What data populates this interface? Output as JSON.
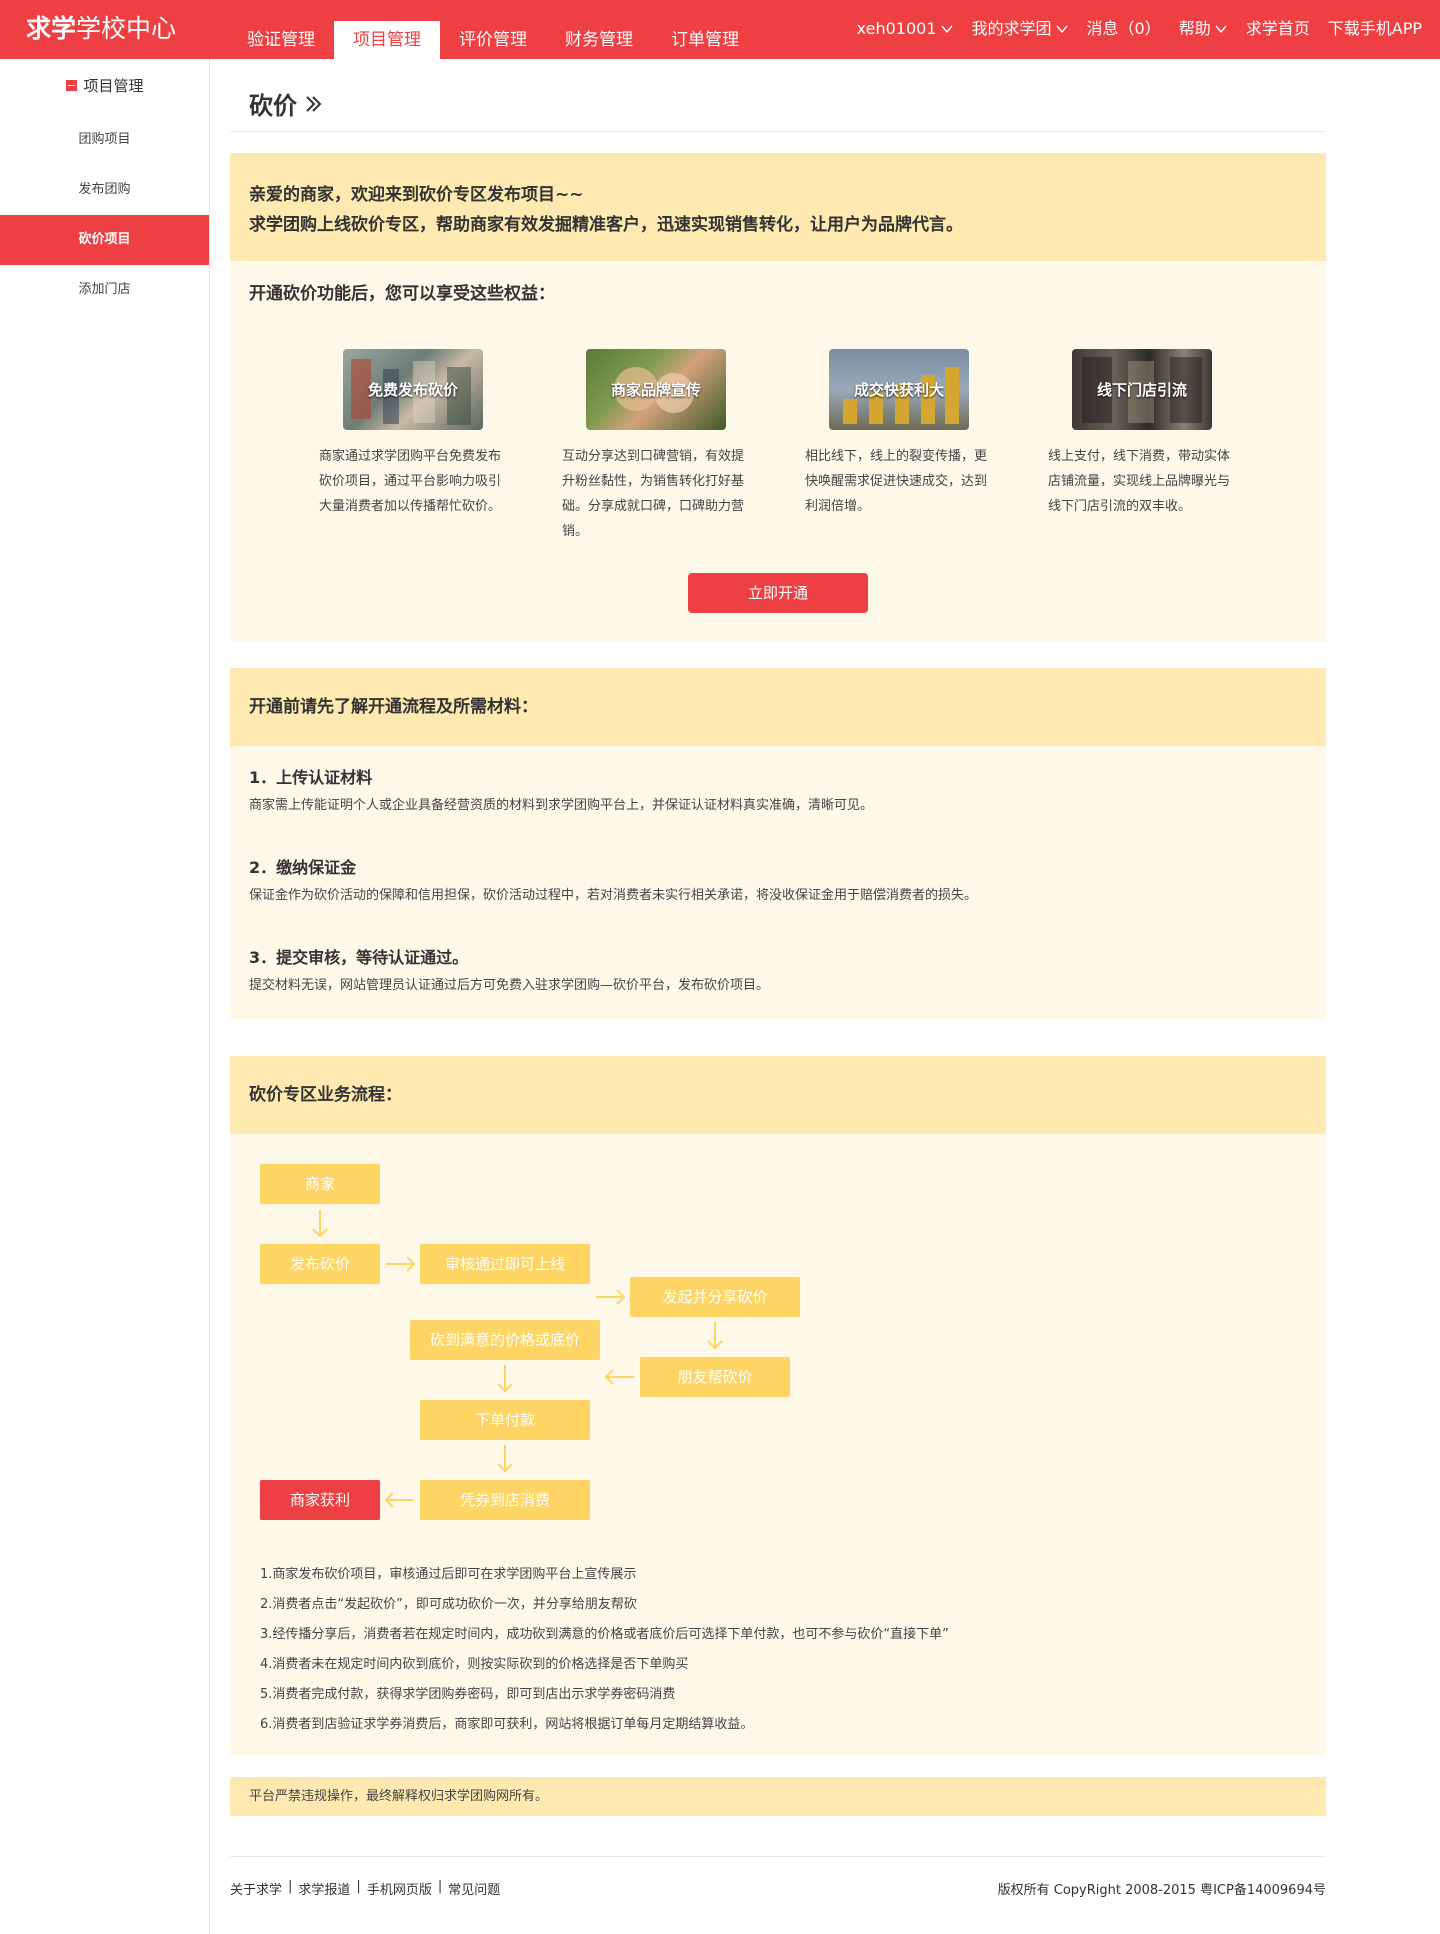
{
  "header": {
    "brand_bold": "求学",
    "brand_rest": "学校中心",
    "tabs": [
      {
        "label": "验证管理"
      },
      {
        "label": "项目管理"
      },
      {
        "label": "评价管理"
      },
      {
        "label": "财务管理"
      },
      {
        "label": "订单管理"
      }
    ],
    "active_tab": "项目管理",
    "links": {
      "user": "xeh01001",
      "my_group": "我的求学团",
      "messages": "消息（0）",
      "help": "帮助",
      "home": "求学首页",
      "app": "下载手机APP"
    },
    "color": "#ee3f43"
  },
  "sidebar": {
    "heading": "项目管理",
    "items": [
      {
        "label": "团购项目"
      },
      {
        "label": "发布团购"
      },
      {
        "label": "砍价项目"
      },
      {
        "label": "添加门店"
      }
    ],
    "active_item": "砍价项目"
  },
  "main": {
    "title": "砍价",
    "intro": {
      "line1": "亲爱的商家，欢迎来到砍价专区发布项目~~",
      "line2": "求学团购上线砍价专区，帮助商家有效发掘精准客户，迅速实现销售转化，让用户为品牌代言。"
    },
    "benefits_title": "开通砍价功能后，您可以享受这些权益：",
    "benefits": [
      {
        "caption": "免费发布砍价",
        "desc": "商家通过求学团购平台免费发布砍价项目，通过平台影响力吸引大量消费者加以传播帮忙砍价。"
      },
      {
        "caption": "商家品牌宣传",
        "desc": "互动分享达到口碑营销，有效提升粉丝黏性，为销售转化打好基础。分享成就口碑，口碑助力营销。"
      },
      {
        "caption": "成交快获利大",
        "desc": "相比线下，线上的裂变传播，更快唤醒需求促进快速成交，达到利润倍增。"
      },
      {
        "caption": "线下门店引流",
        "desc": "线上支付，线下消费，带动实体店铺流量，实现线上品牌曝光与线下门店引流的双丰收。"
      }
    ],
    "open_button": "立即开通",
    "process": {
      "title": "开通前请先了解开通流程及所需材料：",
      "steps": [
        {
          "title": "1．上传认证材料",
          "desc": "商家需上传能证明个人或企业具备经营资质的材料到求学团购平台上，并保证认证材料真实准确，清晰可见。"
        },
        {
          "title": "2．缴纳保证金",
          "desc": "保证金作为砍价活动的保障和信用担保，砍价活动过程中，若对消费者未实行相关承诺，将没收保证金用于赔偿消费者的损失。"
        },
        {
          "title": "3．提交审核，等待认证通过。",
          "desc": "提交材料无误，网站管理员认证通过后方可免费入驻求学团购—砍价平台，发布砍价项目。"
        }
      ]
    },
    "flow": {
      "title": "砍价专区业务流程：",
      "nodes": {
        "merchant": "商家",
        "publish": "发布砍价",
        "approved": "审核通过即可上线",
        "share": "发起并分享砍价",
        "friends": "朋友帮砍价",
        "satisfied": "砍到满意的价格或底价",
        "order": "下单付款",
        "voucher": "凭券到店消费",
        "profit": "商家获利"
      },
      "notes": [
        "1.商家发布砍价项目，审核通过后即可在求学团购平台上宣传展示",
        "2.消费者点击“发起砍价”，即可成功砍价一次，并分享给朋友帮砍",
        "3.经传播分享后，消费者若在规定时间内，成功砍到满意的价格或者底价后可选择下单付款，也可不参与砍价“直接下单”",
        "4.消费者未在规定时间内砍到底价，则按实际砍到的价格选择是否下单购买",
        "5.消费者完成付款，获得求学团购券密码，即可到店出示求学券密码消费",
        "6.消费者到店验证求学券消费后，商家即可获利，网站将根据订单每月定期结算收益。"
      ],
      "box_color": "#fed565",
      "profit_color": "#ee3f43"
    },
    "notice": "平台严禁违规操作，最终解释权归求学团购网所有。"
  },
  "footer": {
    "links": [
      "关于求学",
      "求学报道",
      "手机网页版",
      "常见问题"
    ],
    "separator": "|",
    "copyright": "版权所有 CopyRight 2008-2015 粤ICP备14009694号"
  }
}
